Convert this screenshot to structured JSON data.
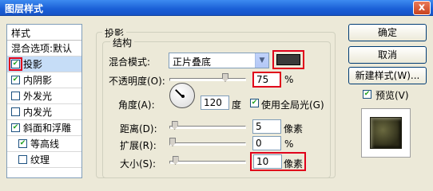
{
  "window": {
    "title": "图层样式",
    "close_label": "x"
  },
  "left_panel": {
    "header": "样式",
    "items": [
      {
        "label": "混合选项:默认",
        "checkbox": false
      },
      {
        "label": "投影",
        "checkbox": true,
        "checked": true,
        "selected": true,
        "highlighted": true
      },
      {
        "label": "内阴影",
        "checkbox": true,
        "checked": true
      },
      {
        "label": "外发光",
        "checkbox": true,
        "checked": false
      },
      {
        "label": "内发光",
        "checkbox": true,
        "checked": false
      },
      {
        "label": "斜面和浮雕",
        "checkbox": true,
        "checked": true
      },
      {
        "label": "等高线",
        "checkbox": true,
        "checked": true,
        "indent": true
      },
      {
        "label": "纹理",
        "checkbox": true,
        "checked": false,
        "indent": true
      }
    ]
  },
  "drop_shadow": {
    "group_title": "投影",
    "structure_title": "结构",
    "blend_mode": {
      "label": "混合模式:",
      "value": "正片叠底",
      "color": "#3a3a3a"
    },
    "opacity": {
      "label": "不透明度(O):",
      "value": "75",
      "unit": "%",
      "level": 0.75
    },
    "angle": {
      "label": "角度(A):",
      "value": "120",
      "unit": "度",
      "global_light_label": "使用全局光(G)",
      "global_light_checked": true
    },
    "distance": {
      "label": "距离(D):",
      "value": "5",
      "unit": "像素",
      "level": 0.03
    },
    "spread": {
      "label": "扩展(R):",
      "value": "0",
      "unit": "%",
      "level": 0.0
    },
    "size": {
      "label": "大小(S):",
      "value": "10",
      "unit": "像素",
      "level": 0.04
    }
  },
  "buttons": {
    "ok": "确定",
    "cancel": "取消",
    "new_style": "新建样式(W)..."
  },
  "preview": {
    "label": "预览(V)",
    "checked": true
  },
  "colors": {
    "highlight_red": "#e0001a",
    "selected_bg": "#c6ddf7"
  }
}
